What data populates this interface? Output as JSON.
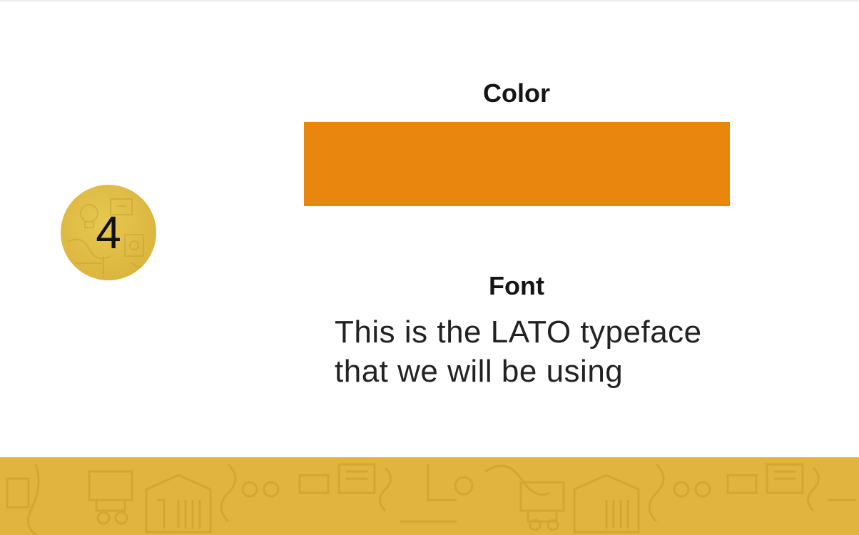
{
  "slide": {
    "step_number": "4",
    "color_section": {
      "heading": "Color",
      "swatch_color": "#e8860e"
    },
    "font_section": {
      "heading": "Font",
      "sample_lines": [
        "This is the LATO typeface",
        "that we will be using"
      ]
    }
  },
  "theme": {
    "accent_gold": "#e0b43e",
    "badge_gold": "#dcb63f"
  }
}
